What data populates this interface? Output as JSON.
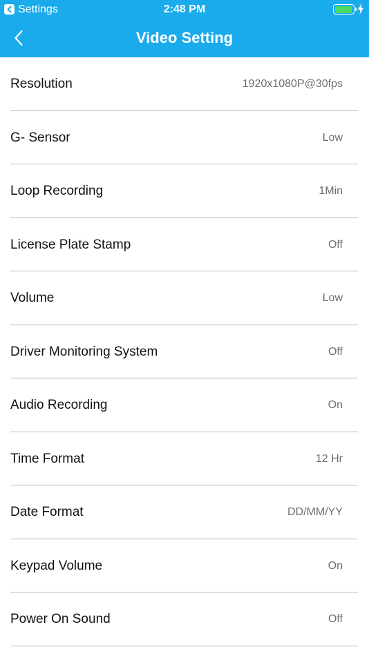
{
  "status_bar": {
    "back_app": "Settings",
    "time": "2:48 PM",
    "battery_level": 0.95,
    "battery_color": "#4cd964"
  },
  "nav": {
    "title": "Video Setting",
    "back_icon": "chevron-left-icon",
    "bar_color": "#1aabec"
  },
  "settings": [
    {
      "label": "Resolution",
      "value": "1920x1080P@30fps"
    },
    {
      "label": "G- Sensor",
      "value": "Low"
    },
    {
      "label": "Loop Recording",
      "value": "1Min"
    },
    {
      "label": "License Plate Stamp",
      "value": "Off"
    },
    {
      "label": "Volume",
      "value": "Low"
    },
    {
      "label": "Driver Monitoring System",
      "value": "Off"
    },
    {
      "label": "Audio Recording",
      "value": "On"
    },
    {
      "label": "Time Format",
      "value": "12 Hr"
    },
    {
      "label": "Date Format",
      "value": "DD/MM/YY"
    },
    {
      "label": "Keypad Volume",
      "value": "On"
    },
    {
      "label": "Power On Sound",
      "value": "Off"
    }
  ]
}
